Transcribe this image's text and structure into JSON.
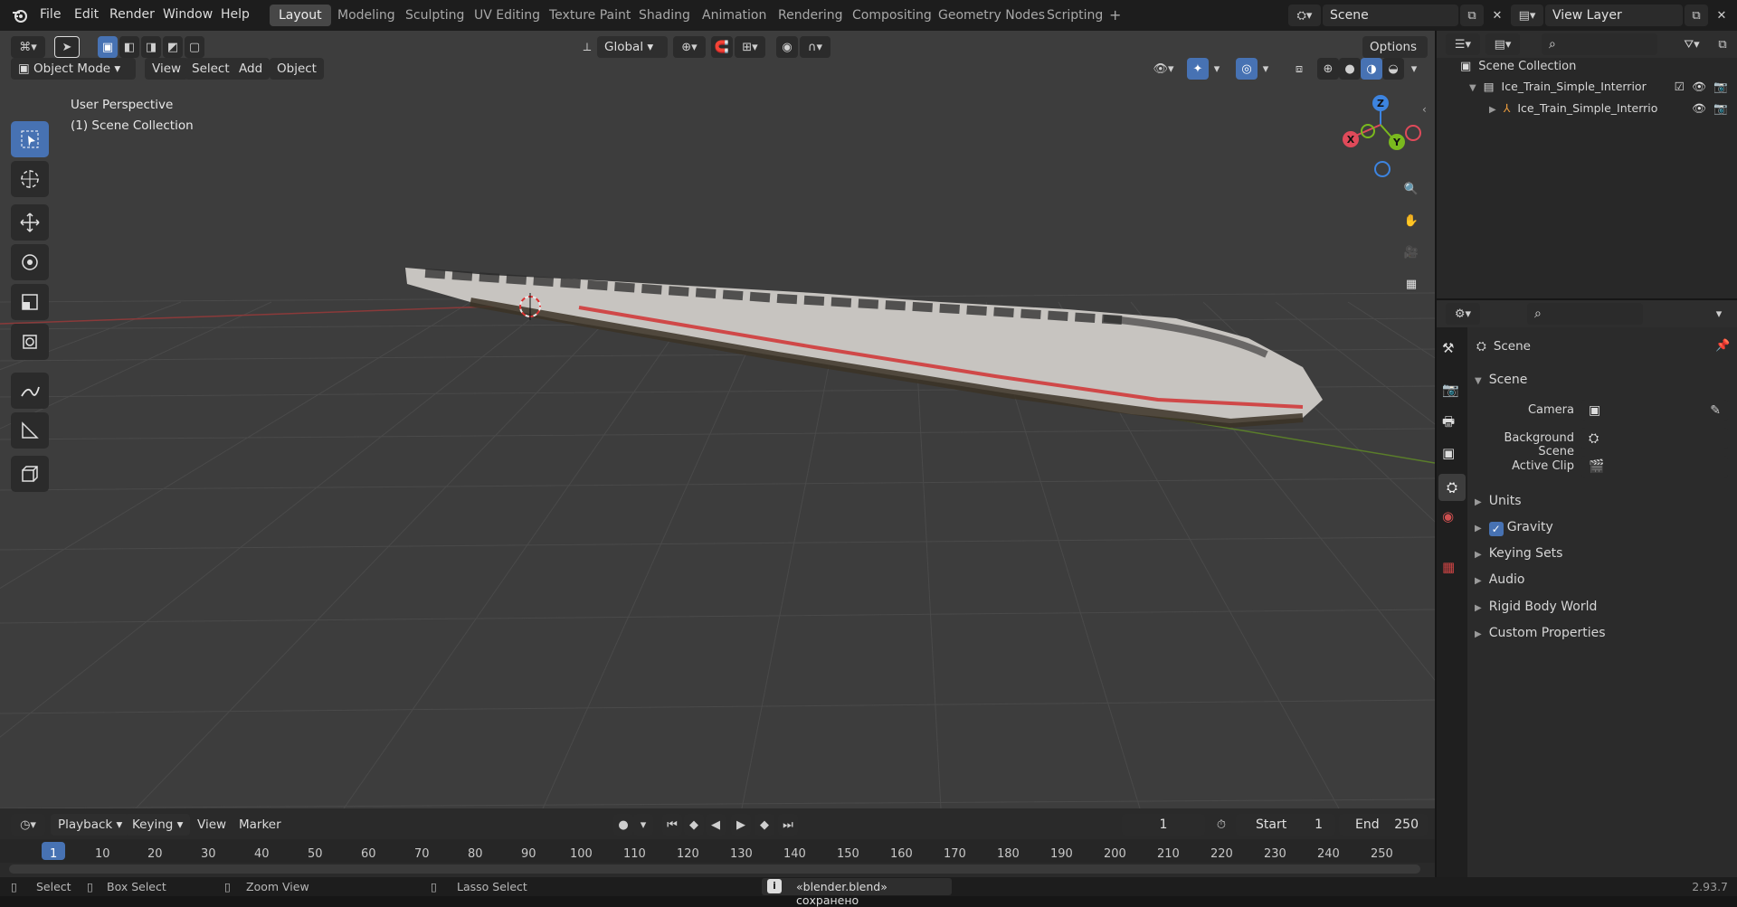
{
  "top_menu": {
    "app_icon": "blender-logo-icon",
    "items": [
      "File",
      "Edit",
      "Render",
      "Window",
      "Help"
    ],
    "workspaces": [
      "Layout",
      "Modeling",
      "Sculpting",
      "UV Editing",
      "Texture Paint",
      "Shading",
      "Animation",
      "Rendering",
      "Compositing",
      "Geometry Nodes",
      "Scripting"
    ],
    "active_workspace": "Layout",
    "add_workspace": "+",
    "scene_name": "Scene",
    "view_layer_name": "View Layer"
  },
  "viewport_header": {
    "orientation": "Global",
    "options_label": "Options",
    "mode": "Object Mode",
    "menus": [
      "View",
      "Select",
      "Add",
      "Object"
    ]
  },
  "viewport": {
    "perspective_label": "User Perspective",
    "collection_label": "(1) Scene Collection",
    "gizmo_axes": {
      "x": "X",
      "y": "Y",
      "z": "Z"
    },
    "axis_colors": {
      "x": "#e04a5a",
      "y": "#7ab91e",
      "z": "#3d84e0"
    },
    "grid_color": "#474747",
    "background_color": "#3d3d3d"
  },
  "toolbar": {
    "tools": [
      "select-box-icon",
      "cursor-icon",
      "move-icon",
      "rotate-icon",
      "scale-icon",
      "transform-icon",
      "annotate-icon",
      "measure-icon",
      "add-cube-icon"
    ],
    "active_tool": "select-box-icon"
  },
  "navigation": [
    "zoom-icon",
    "pan-hand-icon",
    "camera-icon",
    "ortho-grid-icon"
  ],
  "outliner": {
    "root": "Scene Collection",
    "items": [
      {
        "label": "Ice_Train_Simple_Interrior",
        "type": "collection-icon",
        "expanded": true
      },
      {
        "label": "Ice_Train_Simple_Interrio",
        "type": "object-icon",
        "expanded": false
      }
    ]
  },
  "properties": {
    "context_title": "Scene",
    "section_title": "Scene",
    "fields": [
      {
        "label": "Camera",
        "value": ""
      },
      {
        "label": "Background Scene",
        "value": ""
      },
      {
        "label": "Active Clip",
        "value": ""
      }
    ],
    "panels": [
      "Units",
      "Gravity",
      "Keying Sets",
      "Audio",
      "Rigid Body World",
      "Custom Properties"
    ],
    "gravity_enabled": true
  },
  "timeline": {
    "menus": [
      "Playback",
      "Keying",
      "View",
      "Marker"
    ],
    "current_frame": "1",
    "start_label": "Start",
    "start_value": "1",
    "end_label": "End",
    "end_value": "250",
    "ruler_ticks": [
      "1",
      "10",
      "20",
      "30",
      "40",
      "50",
      "60",
      "70",
      "80",
      "90",
      "100",
      "110",
      "120",
      "130",
      "140",
      "150",
      "160",
      "170",
      "180",
      "190",
      "200",
      "210",
      "220",
      "230",
      "240",
      "250"
    ]
  },
  "status_bar": {
    "select": "Select",
    "box_select": "Box Select",
    "zoom_view": "Zoom View",
    "lasso_select": "Lasso Select",
    "message": "«blender.blend» сохранено",
    "version": "2.93.7"
  }
}
